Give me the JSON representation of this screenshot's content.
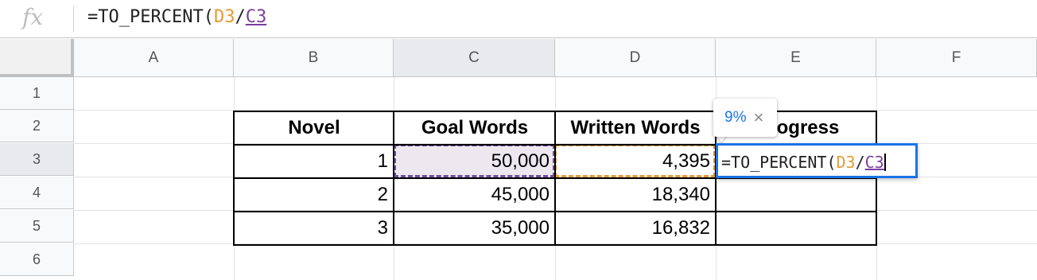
{
  "formula_bar": {
    "icon": "fx",
    "formula_prefix": "=TO_PERCENT(",
    "ref1": "D3",
    "separator": "/",
    "ref2": "C3"
  },
  "columns": [
    "A",
    "B",
    "C",
    "D",
    "E",
    "F"
  ],
  "rows": [
    "1",
    "2",
    "3",
    "4",
    "5",
    "6"
  ],
  "table": {
    "headers": [
      "Novel",
      "Goal Words",
      "Written Words",
      "ogress"
    ],
    "rows": [
      {
        "novel": "1",
        "goal": "50,000",
        "written": "4,395"
      },
      {
        "novel": "2",
        "goal": "45,000",
        "written": "18,340"
      },
      {
        "novel": "3",
        "goal": "35,000",
        "written": "16,832"
      }
    ]
  },
  "editor": {
    "prefix": "=TO_PERCENT(",
    "ref1": "D3",
    "separator": "/",
    "ref2": "C3"
  },
  "tooltip": {
    "value": "9%",
    "close": "×"
  },
  "colors": {
    "ref_d3": "#e69a36",
    "ref_c3": "#7b3f9f",
    "selection": "#1a73e8"
  }
}
